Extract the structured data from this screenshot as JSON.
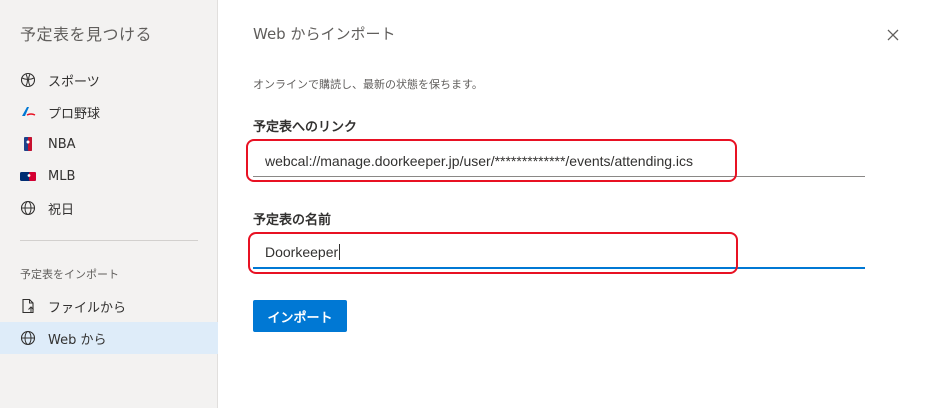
{
  "sidebar": {
    "title": "予定表を見つける",
    "items": [
      {
        "label": "スポーツ",
        "icon": "sports-icon"
      },
      {
        "label": "プロ野球",
        "icon": "pro-baseball-icon"
      },
      {
        "label": "NBA",
        "icon": "nba-icon"
      },
      {
        "label": "MLB",
        "icon": "mlb-icon"
      },
      {
        "label": "祝日",
        "icon": "globe-icon"
      }
    ],
    "import_section_label": "予定表をインポート",
    "import_items": [
      {
        "label": "ファイルから",
        "icon": "file-icon"
      },
      {
        "label": "Web から",
        "icon": "globe-icon"
      }
    ]
  },
  "main": {
    "title": "Web からインポート",
    "description": "オンラインで購読し、最新の状態を保ちます。",
    "link_label": "予定表へのリンク",
    "link_value": "webcal://manage.doorkeeper.jp/user/*************/events/attending.ics",
    "name_label": "予定表の名前",
    "name_value": "Doorkeeper",
    "import_button": "インポート"
  },
  "colors": {
    "accent": "#0078d4",
    "highlight": "#e81123",
    "sidebar_active": "#deecf9"
  }
}
